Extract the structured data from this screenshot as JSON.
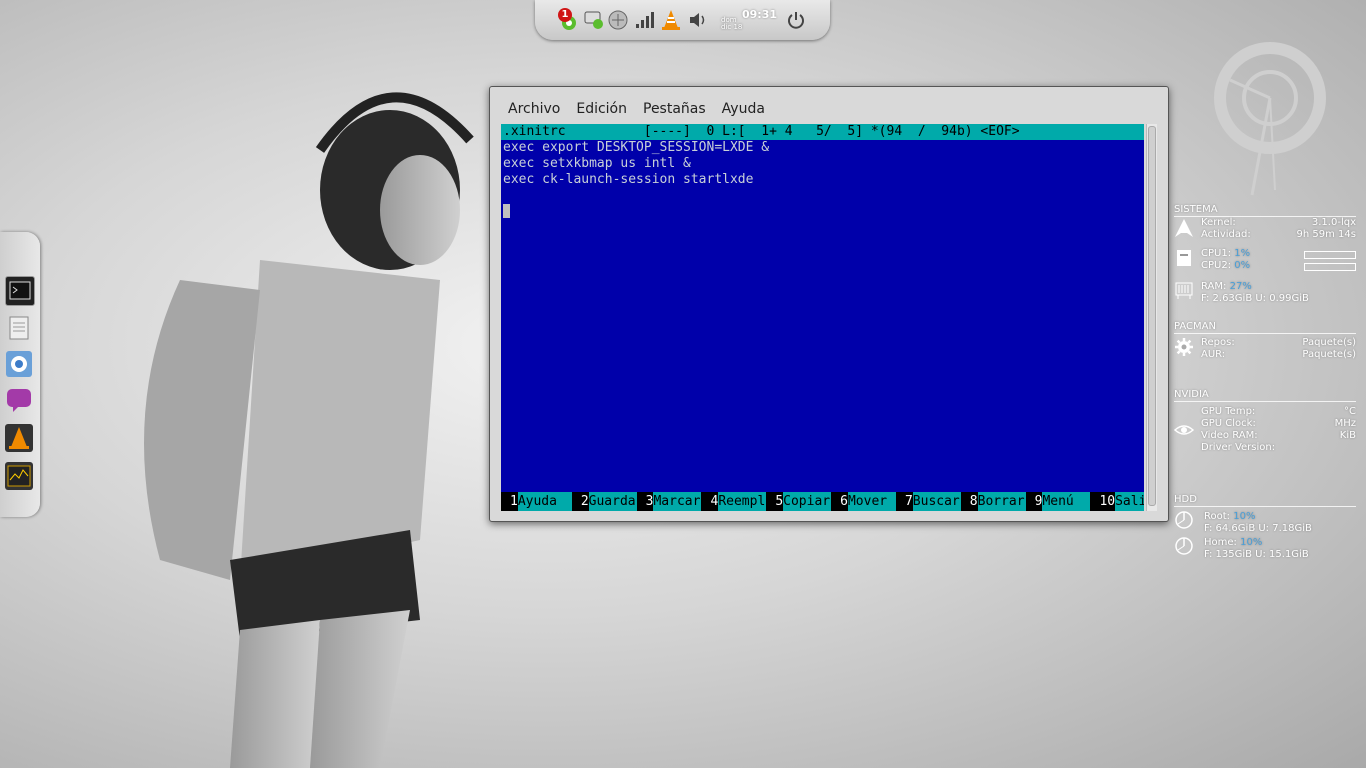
{
  "tray": {
    "notification_count": "1",
    "clock_time": "09:31",
    "clock_top": "jueves",
    "clock_date_line1": "dom",
    "clock_date_line2": "dic 18"
  },
  "dock": {
    "items": [
      "terminal-icon",
      "text-editor-icon",
      "chromium-icon",
      "chat-icon",
      "vlc-icon",
      "system-monitor-icon"
    ]
  },
  "window": {
    "menu": [
      "Archivo",
      "Edición",
      "Pestañas",
      "Ayuda"
    ],
    "status_line": ".xinitrc          [----]  0 L:[  1+ 4   5/  5] *(94  /  94b) <EOF>",
    "code": [
      "exec export DESKTOP_SESSION=LXDE &",
      "exec setxkbmap us intl &",
      "exec ck-launch-session startlxde"
    ],
    "fkeys": [
      {
        "num": "1",
        "label": "Ayuda"
      },
      {
        "num": "2",
        "label": "Guarda"
      },
      {
        "num": "3",
        "label": "Marcar"
      },
      {
        "num": "4",
        "label": "Reempl"
      },
      {
        "num": "5",
        "label": "Copiar"
      },
      {
        "num": "6",
        "label": "Mover"
      },
      {
        "num": "7",
        "label": "Buscar"
      },
      {
        "num": "8",
        "label": "Borrar"
      },
      {
        "num": "9",
        "label": "Menú"
      },
      {
        "num": "10",
        "label": "Salir"
      }
    ]
  },
  "conky": {
    "sistema": {
      "title": "SISTEMA",
      "kernel_label": "Kernel:",
      "kernel_value": "3.1.0-lqx",
      "uptime_label": "Actividad:",
      "uptime_value": "9h 59m 14s",
      "cpu1_label": "CPU1:",
      "cpu1_value": "1%",
      "cpu2_label": "CPU2:",
      "cpu2_value": "0%",
      "cpu1_fill": 0.01,
      "cpu2_fill": 0.0,
      "ram_label": "RAM:",
      "ram_value": "27%",
      "ram_detail": "F: 2.63GiB U: 0.99GiB"
    },
    "pacman": {
      "title": "PACMAN",
      "repos_label": "Repos:",
      "repos_value": "Paquete(s)",
      "aur_label": "AUR:",
      "aur_value": "Paquete(s)"
    },
    "nvidia": {
      "title": "NVIDIA",
      "gpu_temp_label": "GPU Temp:",
      "gpu_temp_unit": "°C",
      "gpu_clock_label": "GPU Clock:",
      "gpu_clock_unit": "MHz",
      "vram_label": "Video RAM:",
      "vram_unit": "KiB",
      "driver_label": "Driver Version:"
    },
    "hdd": {
      "title": "HDD",
      "root_label": "Root:",
      "root_value": "10%",
      "root_detail": "F: 64.6GiB U: 7.18GiB",
      "home_label": "Home:",
      "home_value": "10%",
      "home_detail": "F: 135GiB U: 15.1GiB"
    }
  },
  "colors": {
    "terminal_bg": "#0000aa",
    "terminal_status_bg": "#00aaaa",
    "conky_accent": "#4a9fd8"
  }
}
